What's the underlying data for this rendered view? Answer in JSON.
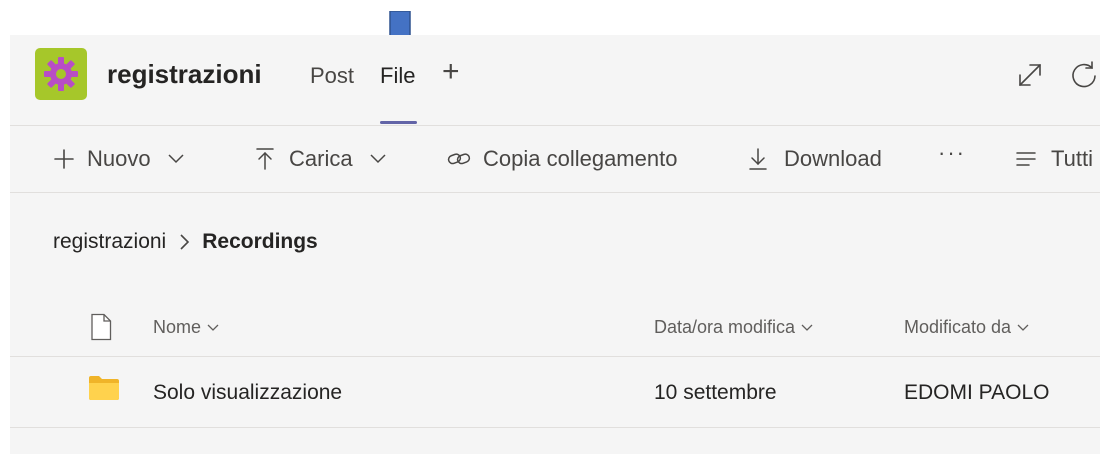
{
  "header": {
    "team_name": "registrazioni",
    "tabs": [
      {
        "label": "Post",
        "active": false
      },
      {
        "label": "File",
        "active": true
      }
    ],
    "add_tab_label": "+",
    "avatar_color": "#a6c72a",
    "avatar_icon": "gear-icon",
    "accent_color": "#6264a7"
  },
  "toolbar": {
    "new_label": "Nuovo",
    "upload_label": "Carica",
    "copy_link_label": "Copia collegamento",
    "download_label": "Download",
    "more_label": "···",
    "view_label": "Tutti"
  },
  "breadcrumb": {
    "root": "registrazioni",
    "current": "Recordings"
  },
  "table": {
    "columns": [
      "Nome",
      "Data/ora modifica",
      "Modificato da"
    ],
    "rows": [
      {
        "name": "Solo visualizzazione",
        "modified": "10 settembre",
        "modified_by": "EDOMI PAOLO",
        "type": "folder"
      }
    ]
  },
  "annotation": {
    "arrow_color": "#4472c4"
  }
}
